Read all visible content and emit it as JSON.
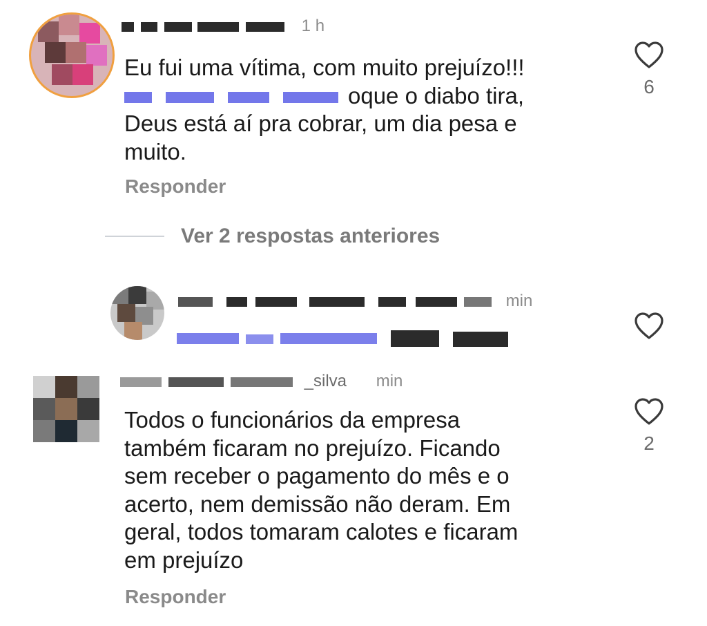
{
  "comments": [
    {
      "timestamp": "1 h",
      "text_line1": "Eu fui uma vítima, com muito prejuízo!!!",
      "text_line2": "oque o diabo tira,",
      "text_line3": "Deus está aí pra cobrar, um dia pesa e",
      "text_line4": "muito.",
      "reply_label": "Responder",
      "like_count": "6"
    },
    {
      "timestamp": "min"
    },
    {
      "username_fragment": "_silva",
      "timestamp": "min",
      "text_line1": "Todos o funcionários da empresa",
      "text_line2": "também ficaram no prejuízo. Ficando",
      "text_line3": "sem receber o pagamento do mês e o",
      "text_line4": "acerto, nem demissão não deram. Em",
      "text_line5": "geral, todos tomaram calotes e ficaram",
      "text_line6": "em prejuízo",
      "reply_label": "Responder",
      "like_count": "2"
    }
  ],
  "view_replies_label": "Ver 2 respostas anteriores",
  "colors": {
    "mention": "#5a5fe6",
    "muted": "#8a8a8a",
    "text": "#1a1a1a"
  },
  "icons": {
    "like": "heart-outline-icon"
  }
}
